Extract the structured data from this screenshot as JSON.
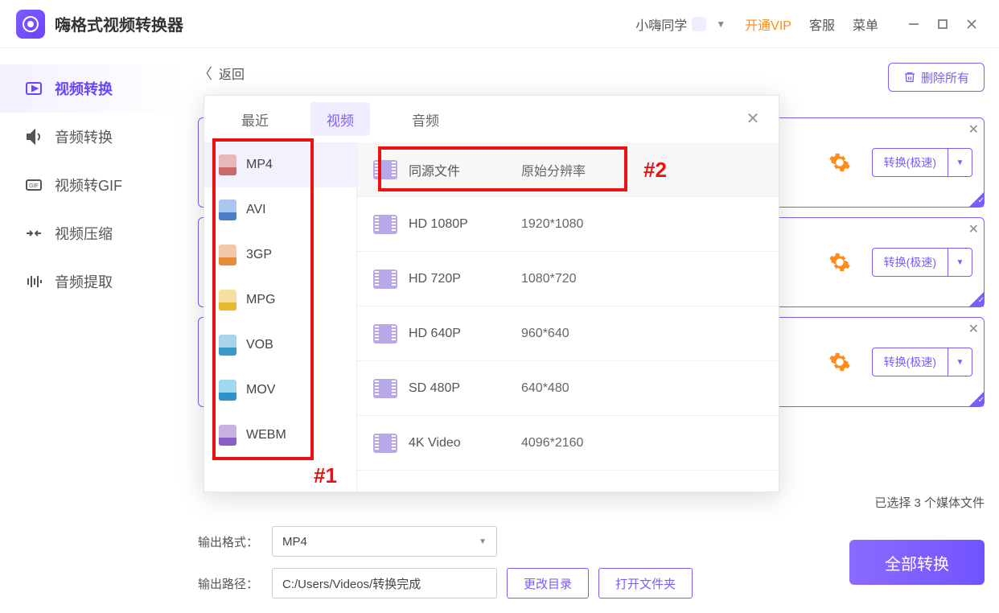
{
  "app": {
    "title": "嗨格式视频转换器"
  },
  "header": {
    "user": "小嗨同学",
    "vip": "开通VIP",
    "support": "客服",
    "menu": "菜单"
  },
  "sidebar": {
    "items": [
      {
        "label": "视频转换"
      },
      {
        "label": "音频转换"
      },
      {
        "label": "视频转GIF"
      },
      {
        "label": "视频压缩"
      },
      {
        "label": "音频提取"
      }
    ]
  },
  "back_label": "返回",
  "delete_all": "删除所有",
  "queue": {
    "convert_label": "转换(极速)"
  },
  "status": "已选择 3 个媒体文件",
  "output": {
    "format_label": "输出格式：",
    "format_value": "MP4",
    "path_label": "输出路径：",
    "path_value": "C:/Users/Videos/转换完成",
    "change_dir": "更改目录",
    "open_folder": "打开文件夹"
  },
  "convert_all": "全部转换",
  "popup": {
    "tabs": {
      "recent": "最近",
      "video": "视频",
      "audio": "音频"
    },
    "formats": [
      "MP4",
      "AVI",
      "3GP",
      "MPG",
      "VOB",
      "MOV",
      "WEBM"
    ],
    "resolutions": [
      {
        "name": "同源文件",
        "value": "原始分辨率"
      },
      {
        "name": "HD 1080P",
        "value": "1920*1080"
      },
      {
        "name": "HD 720P",
        "value": "1080*720"
      },
      {
        "name": "HD 640P",
        "value": "960*640"
      },
      {
        "name": "SD 480P",
        "value": "640*480"
      },
      {
        "name": "4K Video",
        "value": "4096*2160"
      }
    ]
  },
  "annotations": {
    "a1": "#1",
    "a2": "#2"
  }
}
